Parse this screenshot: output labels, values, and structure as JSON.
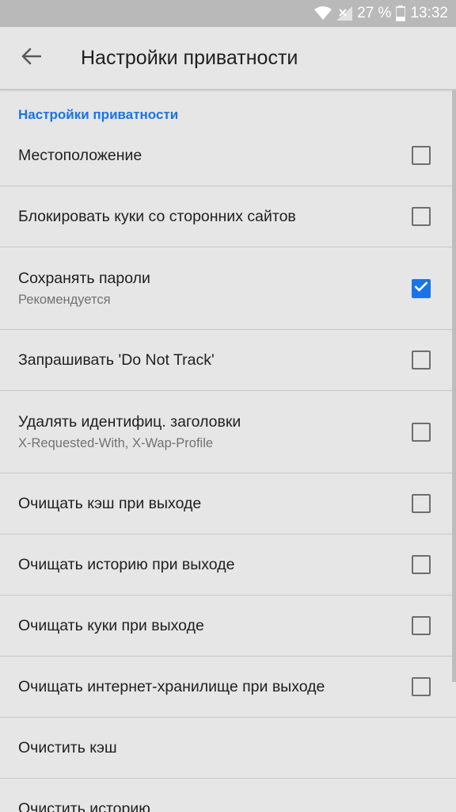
{
  "status_bar": {
    "battery_percent": "27 %",
    "time": "13:32"
  },
  "toolbar": {
    "title": "Настройки приватности"
  },
  "section_header": "Настройки приватности",
  "rows": [
    {
      "title": "Местоположение",
      "subtitle": "",
      "checked": false
    },
    {
      "title": "Блокировать куки со сторонних сайтов",
      "subtitle": "",
      "checked": false
    },
    {
      "title": "Сохранять пароли",
      "subtitle": "Рекомендуется",
      "checked": true
    },
    {
      "title": "Запрашивать 'Do Not Track'",
      "subtitle": "",
      "checked": false
    },
    {
      "title": "Удалять идентифиц. заголовки",
      "subtitle": "X-Requested-With, X-Wap-Profile",
      "checked": false
    },
    {
      "title": "Очищать кэш при выходе",
      "subtitle": "",
      "checked": false
    },
    {
      "title": "Очищать историю при выходе",
      "subtitle": "",
      "checked": false
    },
    {
      "title": "Очищать куки при выходе",
      "subtitle": "",
      "checked": false
    },
    {
      "title": "Очищать интернет-хранилище при выходе",
      "subtitle": "",
      "checked": false
    },
    {
      "title": "Очистить кэш",
      "subtitle": "",
      "checked": null
    },
    {
      "title": "Очистить историю",
      "subtitle": "",
      "checked": null
    }
  ],
  "colors": {
    "accent": "#1a73e8",
    "status_bar": "#b9b9b9",
    "background": "#e6e6e6"
  }
}
